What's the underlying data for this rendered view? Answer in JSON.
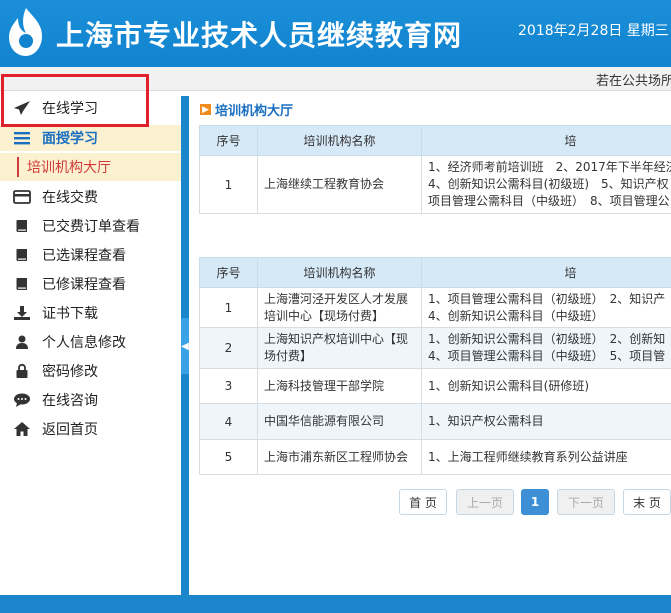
{
  "header": {
    "title": "上海市专业技术人员继续教育网",
    "date": "2018年2月28日 星期三"
  },
  "notice": {
    "text": "若在公共场所"
  },
  "sidebar": {
    "items": [
      {
        "label": "在线学习",
        "icon": "paper-plane-icon"
      },
      {
        "label": "面授学习",
        "icon": "list-icon"
      },
      {
        "label": "在线交费",
        "icon": "credit-card-icon"
      },
      {
        "label": "已交费订单查看",
        "icon": "book-icon"
      },
      {
        "label": "已选课程查看",
        "icon": "book-icon"
      },
      {
        "label": "已修课程查看",
        "icon": "book-icon"
      },
      {
        "label": "证书下载",
        "icon": "download-icon"
      },
      {
        "label": "个人信息修改",
        "icon": "user-icon"
      },
      {
        "label": "密码修改",
        "icon": "lock-icon"
      },
      {
        "label": "在线咨询",
        "icon": "chat-icon"
      },
      {
        "label": "返回首页",
        "icon": "home-icon"
      }
    ],
    "submenu": {
      "label": "培训机构大厅"
    }
  },
  "main": {
    "section_title": "培训机构大厅",
    "table1": {
      "headers": [
        "序号",
        "培训机构名称",
        "培"
      ],
      "rows": [
        {
          "num": "1",
          "org": "上海继续工程教育协会",
          "lines": [
            "1、经济师考前培训班　2、2017年下半年经济",
            "4、创新知识公需科目(初级班)　5、知识产权",
            "项目管理公需科目（中级班）　8、项目管理公"
          ]
        }
      ]
    },
    "table2": {
      "headers": [
        "序号",
        "培训机构名称",
        "培"
      ],
      "rows": [
        {
          "num": "1",
          "org": "上海漕河泾开发区人才发展培训中心【现场付费】",
          "lines": [
            "1、项目管理公需科目（初级班）　2、知识产",
            "4、创新知识公需科目（中级班）"
          ]
        },
        {
          "num": "2",
          "org": "上海知识产权培训中心【现场付费】",
          "lines": [
            "1、创新知识公需科目（初级班）　2、创新知",
            "4、项目管理公需科目（中级班）　5、项目管"
          ]
        },
        {
          "num": "3",
          "org": "上海科技管理干部学院",
          "lines": [
            "1、创新知识公需科目(研修班)"
          ]
        },
        {
          "num": "4",
          "org": "中国华信能源有限公司",
          "lines": [
            "1、知识产权公需科目"
          ]
        },
        {
          "num": "5",
          "org": "上海市浦东新区工程师协会",
          "lines": [
            "1、上海工程师继续教育系列公益讲座"
          ]
        }
      ]
    },
    "pager": {
      "first": "首 页",
      "prev": "上一页",
      "current": "1",
      "next": "下一页",
      "last": "末 页"
    }
  },
  "colors": {
    "header_blue": "#1283cf",
    "active_bg": "#fbf1d0",
    "submenu_red": "#d23a3a",
    "highlight_box": "#e0202a",
    "page_active": "#3d8fd6"
  }
}
